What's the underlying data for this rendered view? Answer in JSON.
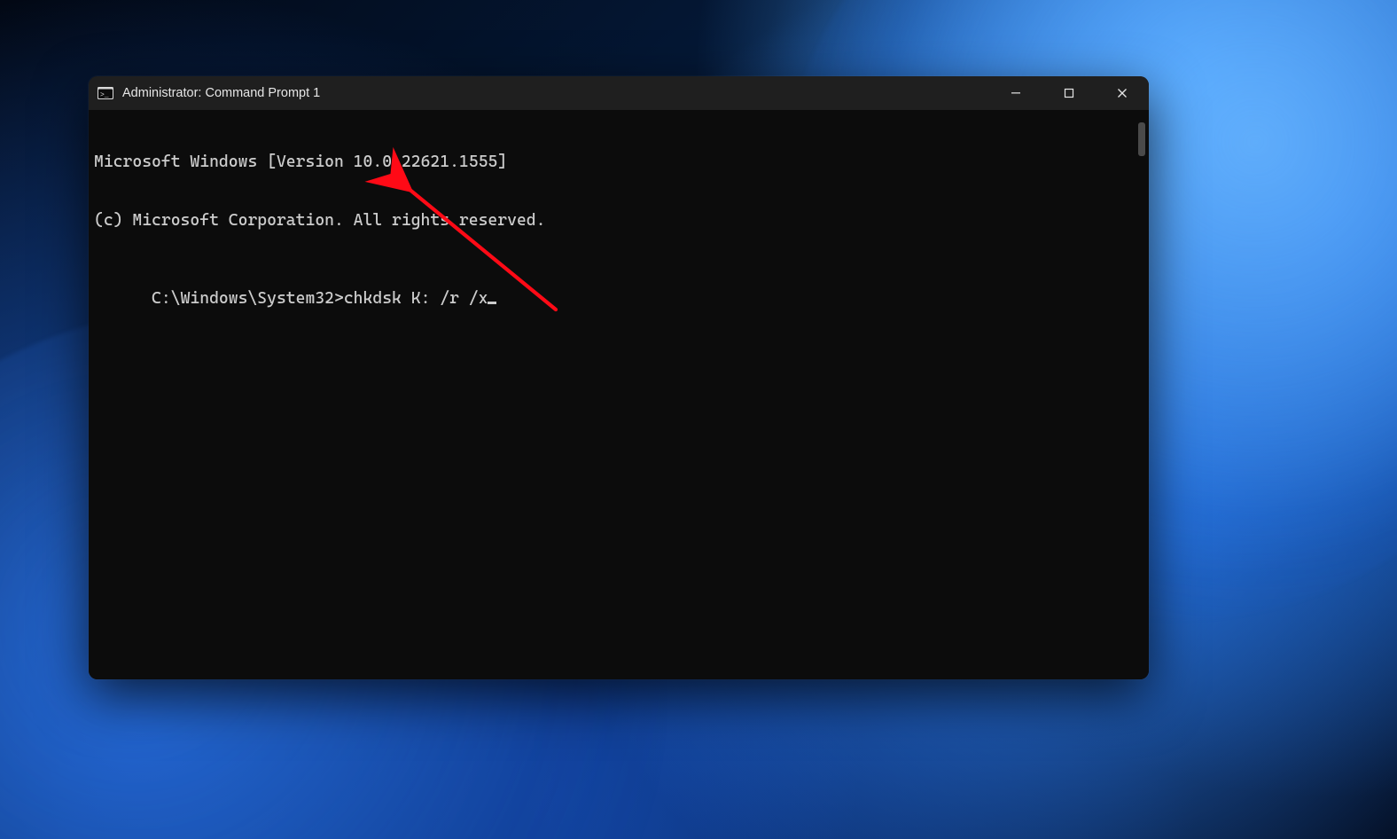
{
  "window": {
    "title": "Administrator: Command Prompt 1"
  },
  "terminal": {
    "lines": [
      "Microsoft Windows [Version 10.0.22621.1555]",
      "(c) Microsoft Corporation. All rights reserved.",
      ""
    ],
    "prompt": "C:\\Windows\\System32>",
    "command": "chkdsk K: /r /x"
  },
  "annotation": {
    "color": "#ff0a16"
  }
}
